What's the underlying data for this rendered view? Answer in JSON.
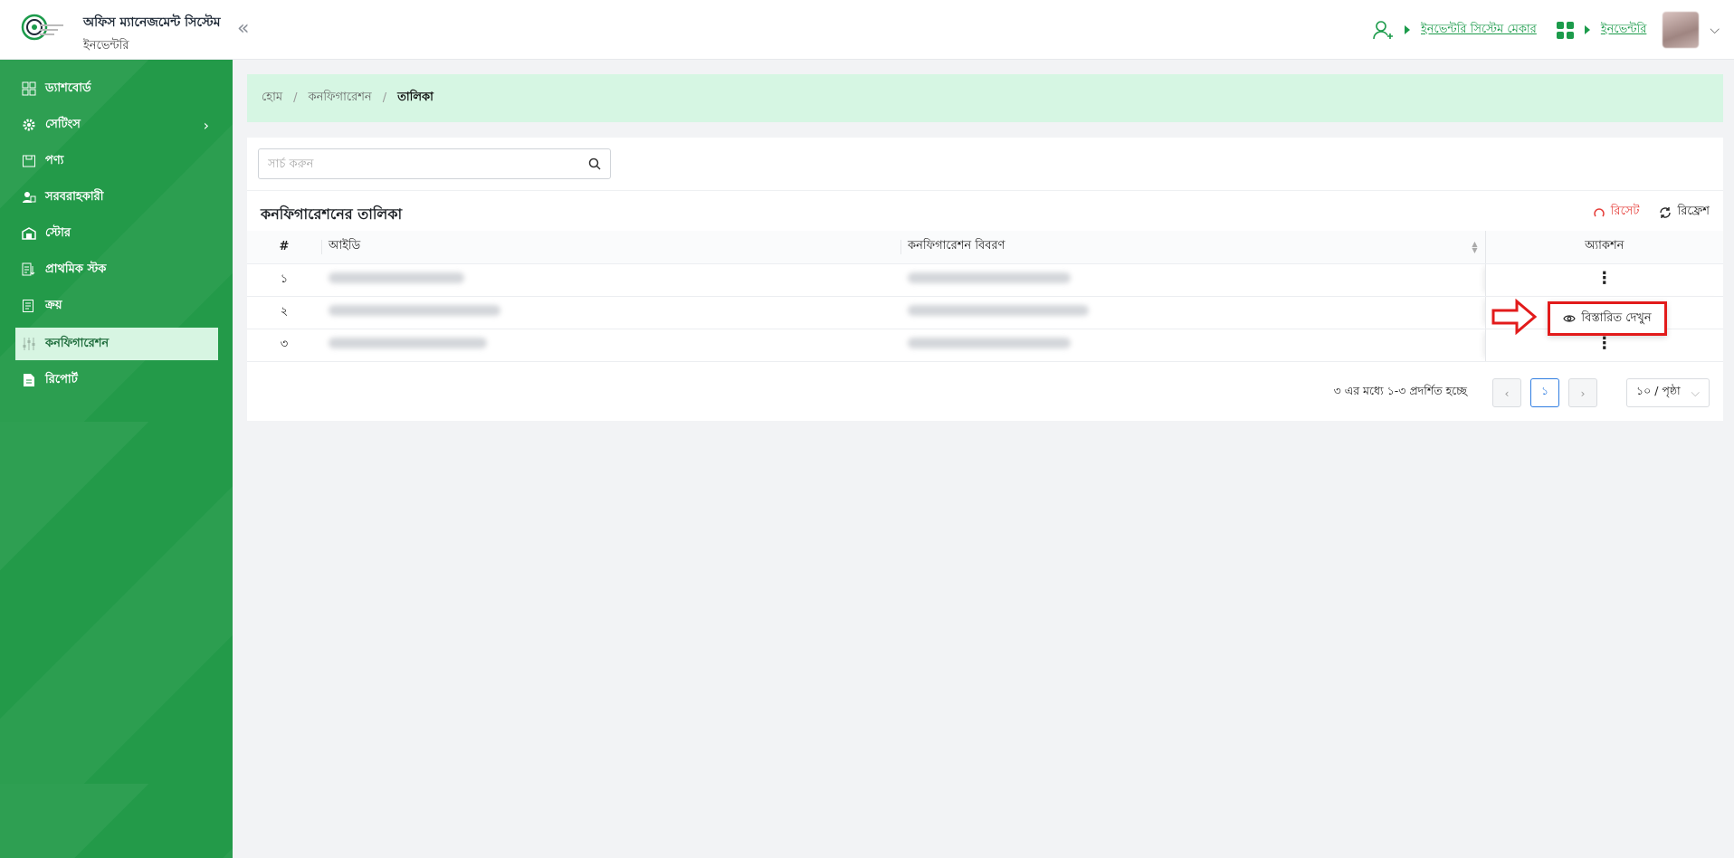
{
  "header": {
    "app_title": "অফিস ম্যানেজমেন্ট সিস্টেম",
    "app_subtitle": "ইনভেন্টরি",
    "user_role_link": "ইনভেন্টরি সিস্টেম মেকার",
    "module_link": "ইনভেন্টরি"
  },
  "sidebar": {
    "items": [
      {
        "label": "ড্যাশবোর্ড",
        "icon": "dashboard-icon"
      },
      {
        "label": "সেটিংস",
        "icon": "gear-icon"
      },
      {
        "label": "পণ্য",
        "icon": "product-icon"
      },
      {
        "label": "সরবরাহকারী",
        "icon": "supplier-icon"
      },
      {
        "label": "স্টোর",
        "icon": "store-icon"
      },
      {
        "label": "প্রাথমিক স্টক",
        "icon": "stock-icon"
      },
      {
        "label": "ক্রয়",
        "icon": "purchase-icon"
      },
      {
        "label": "কনফিগারেশন",
        "icon": "config-icon"
      },
      {
        "label": "রিপোর্ট",
        "icon": "report-icon"
      }
    ]
  },
  "breadcrumb": {
    "home": "হোম",
    "section": "কনফিগারেশন",
    "current": "তালিকা"
  },
  "search": {
    "placeholder": "সার্চ করুন"
  },
  "table": {
    "title": "কনফিগারেশনের তালিকা",
    "reset_label": "রিসেট",
    "refresh_label": "রিফ্রেশ",
    "columns": {
      "num": "#",
      "id": "আইডি",
      "desc": "কনফিগারেশন বিবরণ",
      "action": "অ্যাকশন"
    },
    "rows": [
      {
        "num": "১"
      },
      {
        "num": "২"
      },
      {
        "num": "৩"
      }
    ],
    "action_menu_item": "বিস্তারিত দেখুন"
  },
  "pagination": {
    "info": "৩ এর মধ্যে ১-৩ প্রদর্শিত হচ্ছে",
    "current_page": "১",
    "page_size": "১০ / পৃষ্ঠা"
  },
  "colors": {
    "primary": "#239a49",
    "link": "#1c9b4b",
    "highlight": "#e21b1b"
  }
}
